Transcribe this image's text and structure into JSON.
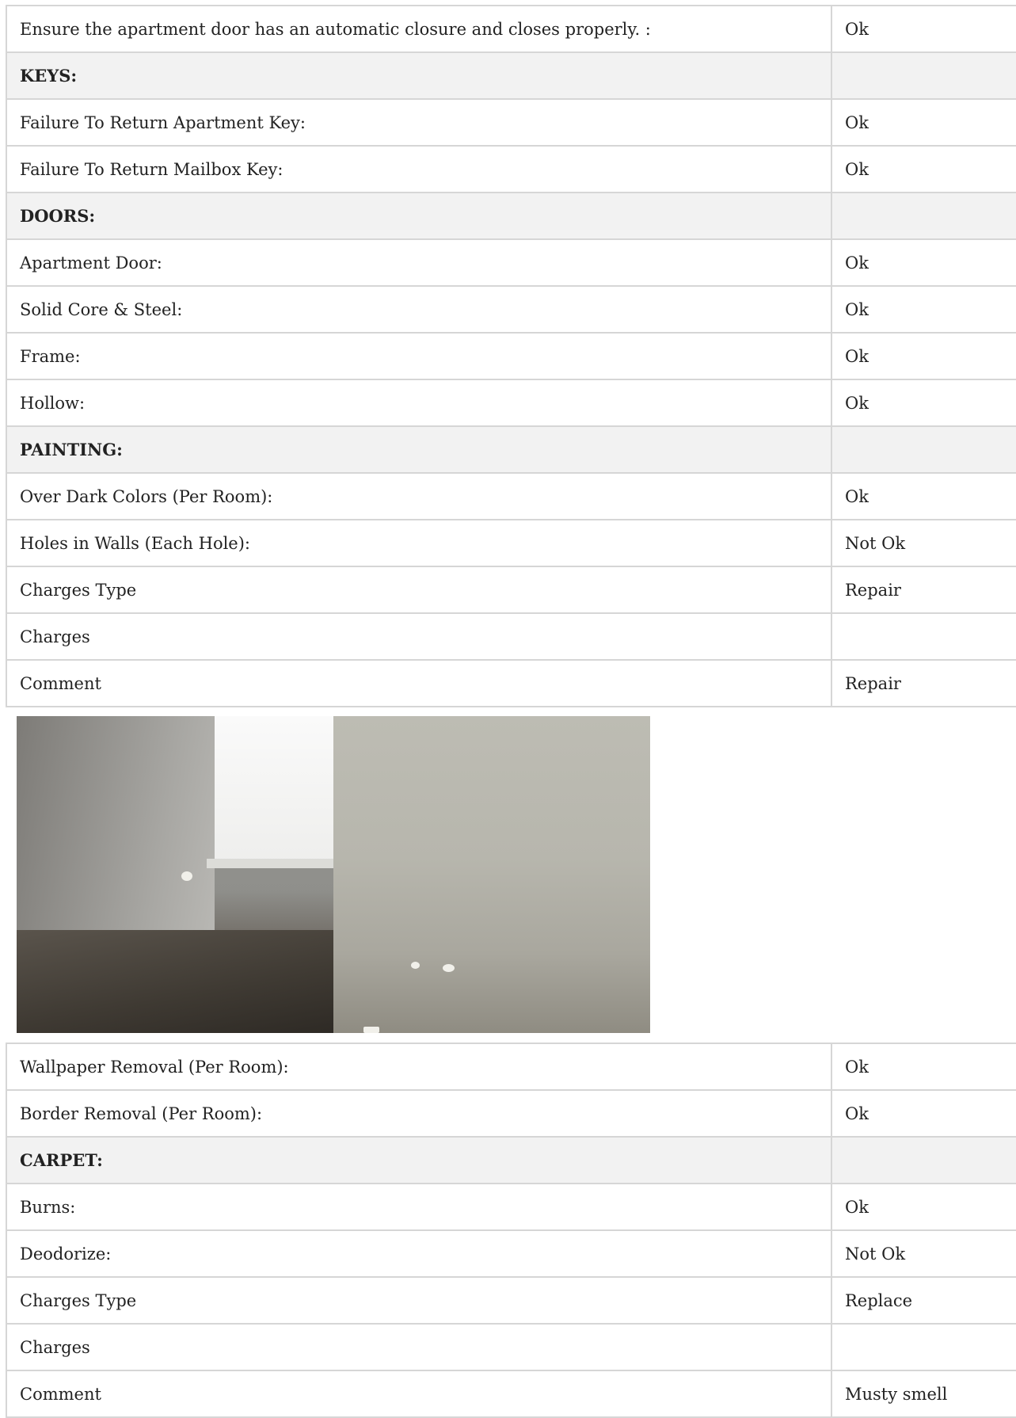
{
  "table_top": {
    "rows": [
      {
        "label": "Ensure the apartment door has an automatic closure and closes properly. :",
        "value": "Ok",
        "section": false
      },
      {
        "label": "KEYS:",
        "value": "",
        "section": true
      },
      {
        "label": "Failure To Return Apartment Key:",
        "value": "Ok",
        "section": false
      },
      {
        "label": "Failure To Return Mailbox Key:",
        "value": "Ok",
        "section": false
      },
      {
        "label": "DOORS:",
        "value": "",
        "section": true
      },
      {
        "label": "Apartment Door:",
        "value": "Ok",
        "section": false
      },
      {
        "label": "Solid Core & Steel:",
        "value": "Ok",
        "section": false
      },
      {
        "label": "Frame:",
        "value": "Ok",
        "section": false
      },
      {
        "label": "Hollow:",
        "value": "Ok",
        "section": false
      },
      {
        "label": "PAINTING:",
        "value": "",
        "section": true
      },
      {
        "label": "Over Dark Colors (Per Room):",
        "value": "Ok",
        "section": false
      },
      {
        "label": "Holes in Walls (Each Hole):",
        "value": "Not Ok",
        "section": false
      },
      {
        "label": "Charges Type",
        "value": "Repair",
        "section": false
      },
      {
        "label": "Charges",
        "value": "",
        "section": false
      },
      {
        "label": "Comment",
        "value": "Repair",
        "section": false
      }
    ]
  },
  "photos": {
    "items": [
      {
        "name": "wall-holes-photo-1"
      },
      {
        "name": "wall-holes-photo-2"
      }
    ]
  },
  "table_bottom": {
    "rows": [
      {
        "label": "Wallpaper Removal (Per Room):",
        "value": "Ok",
        "section": false
      },
      {
        "label": "Border Removal (Per Room):",
        "value": "Ok",
        "section": false
      },
      {
        "label": "CARPET:",
        "value": "",
        "section": true
      },
      {
        "label": "Burns:",
        "value": "Ok",
        "section": false
      },
      {
        "label": "Deodorize:",
        "value": "Not Ok",
        "section": false
      },
      {
        "label": "Charges Type",
        "value": "Replace",
        "section": false
      },
      {
        "label": "Charges",
        "value": "",
        "section": false
      },
      {
        "label": "Comment",
        "value": "Musty smell",
        "section": false
      }
    ]
  }
}
